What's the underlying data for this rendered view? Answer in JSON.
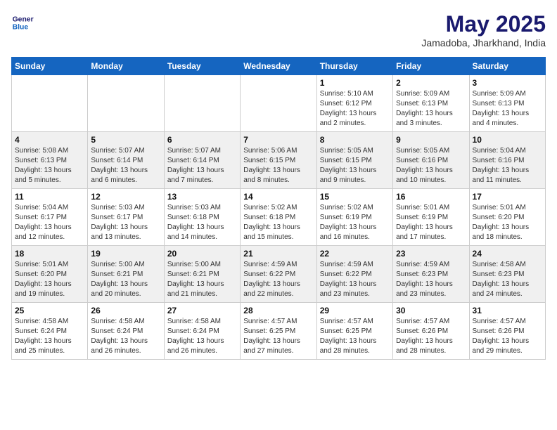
{
  "header": {
    "logo_line1": "General",
    "logo_line2": "Blue",
    "month": "May 2025",
    "location": "Jamadoba, Jharkhand, India"
  },
  "days_of_week": [
    "Sunday",
    "Monday",
    "Tuesday",
    "Wednesday",
    "Thursday",
    "Friday",
    "Saturday"
  ],
  "weeks": [
    [
      {
        "day": "",
        "info": ""
      },
      {
        "day": "",
        "info": ""
      },
      {
        "day": "",
        "info": ""
      },
      {
        "day": "",
        "info": ""
      },
      {
        "day": "1",
        "info": "Sunrise: 5:10 AM\nSunset: 6:12 PM\nDaylight: 13 hours\nand 2 minutes."
      },
      {
        "day": "2",
        "info": "Sunrise: 5:09 AM\nSunset: 6:13 PM\nDaylight: 13 hours\nand 3 minutes."
      },
      {
        "day": "3",
        "info": "Sunrise: 5:09 AM\nSunset: 6:13 PM\nDaylight: 13 hours\nand 4 minutes."
      }
    ],
    [
      {
        "day": "4",
        "info": "Sunrise: 5:08 AM\nSunset: 6:13 PM\nDaylight: 13 hours\nand 5 minutes."
      },
      {
        "day": "5",
        "info": "Sunrise: 5:07 AM\nSunset: 6:14 PM\nDaylight: 13 hours\nand 6 minutes."
      },
      {
        "day": "6",
        "info": "Sunrise: 5:07 AM\nSunset: 6:14 PM\nDaylight: 13 hours\nand 7 minutes."
      },
      {
        "day": "7",
        "info": "Sunrise: 5:06 AM\nSunset: 6:15 PM\nDaylight: 13 hours\nand 8 minutes."
      },
      {
        "day": "8",
        "info": "Sunrise: 5:05 AM\nSunset: 6:15 PM\nDaylight: 13 hours\nand 9 minutes."
      },
      {
        "day": "9",
        "info": "Sunrise: 5:05 AM\nSunset: 6:16 PM\nDaylight: 13 hours\nand 10 minutes."
      },
      {
        "day": "10",
        "info": "Sunrise: 5:04 AM\nSunset: 6:16 PM\nDaylight: 13 hours\nand 11 minutes."
      }
    ],
    [
      {
        "day": "11",
        "info": "Sunrise: 5:04 AM\nSunset: 6:17 PM\nDaylight: 13 hours\nand 12 minutes."
      },
      {
        "day": "12",
        "info": "Sunrise: 5:03 AM\nSunset: 6:17 PM\nDaylight: 13 hours\nand 13 minutes."
      },
      {
        "day": "13",
        "info": "Sunrise: 5:03 AM\nSunset: 6:18 PM\nDaylight: 13 hours\nand 14 minutes."
      },
      {
        "day": "14",
        "info": "Sunrise: 5:02 AM\nSunset: 6:18 PM\nDaylight: 13 hours\nand 15 minutes."
      },
      {
        "day": "15",
        "info": "Sunrise: 5:02 AM\nSunset: 6:19 PM\nDaylight: 13 hours\nand 16 minutes."
      },
      {
        "day": "16",
        "info": "Sunrise: 5:01 AM\nSunset: 6:19 PM\nDaylight: 13 hours\nand 17 minutes."
      },
      {
        "day": "17",
        "info": "Sunrise: 5:01 AM\nSunset: 6:20 PM\nDaylight: 13 hours\nand 18 minutes."
      }
    ],
    [
      {
        "day": "18",
        "info": "Sunrise: 5:01 AM\nSunset: 6:20 PM\nDaylight: 13 hours\nand 19 minutes."
      },
      {
        "day": "19",
        "info": "Sunrise: 5:00 AM\nSunset: 6:21 PM\nDaylight: 13 hours\nand 20 minutes."
      },
      {
        "day": "20",
        "info": "Sunrise: 5:00 AM\nSunset: 6:21 PM\nDaylight: 13 hours\nand 21 minutes."
      },
      {
        "day": "21",
        "info": "Sunrise: 4:59 AM\nSunset: 6:22 PM\nDaylight: 13 hours\nand 22 minutes."
      },
      {
        "day": "22",
        "info": "Sunrise: 4:59 AM\nSunset: 6:22 PM\nDaylight: 13 hours\nand 23 minutes."
      },
      {
        "day": "23",
        "info": "Sunrise: 4:59 AM\nSunset: 6:23 PM\nDaylight: 13 hours\nand 23 minutes."
      },
      {
        "day": "24",
        "info": "Sunrise: 4:58 AM\nSunset: 6:23 PM\nDaylight: 13 hours\nand 24 minutes."
      }
    ],
    [
      {
        "day": "25",
        "info": "Sunrise: 4:58 AM\nSunset: 6:24 PM\nDaylight: 13 hours\nand 25 minutes."
      },
      {
        "day": "26",
        "info": "Sunrise: 4:58 AM\nSunset: 6:24 PM\nDaylight: 13 hours\nand 26 minutes."
      },
      {
        "day": "27",
        "info": "Sunrise: 4:58 AM\nSunset: 6:24 PM\nDaylight: 13 hours\nand 26 minutes."
      },
      {
        "day": "28",
        "info": "Sunrise: 4:57 AM\nSunset: 6:25 PM\nDaylight: 13 hours\nand 27 minutes."
      },
      {
        "day": "29",
        "info": "Sunrise: 4:57 AM\nSunset: 6:25 PM\nDaylight: 13 hours\nand 28 minutes."
      },
      {
        "day": "30",
        "info": "Sunrise: 4:57 AM\nSunset: 6:26 PM\nDaylight: 13 hours\nand 28 minutes."
      },
      {
        "day": "31",
        "info": "Sunrise: 4:57 AM\nSunset: 6:26 PM\nDaylight: 13 hours\nand 29 minutes."
      }
    ]
  ]
}
